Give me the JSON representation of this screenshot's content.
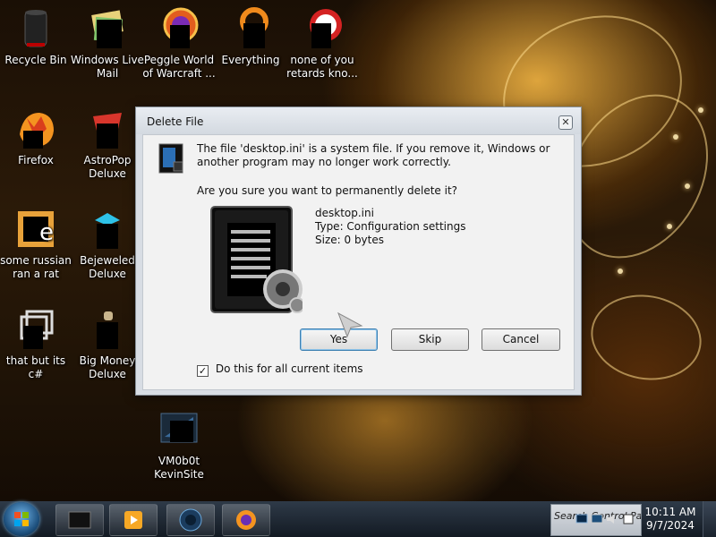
{
  "desktop": {
    "icons": [
      {
        "label": "Recycle Bin",
        "icon": "recycle-bin-icon"
      },
      {
        "label": "Windows Live Mail",
        "icon": "windows-live-mail-icon"
      },
      {
        "label": "Peggle World of Warcraft ...",
        "icon": "peggle-icon"
      },
      {
        "label": "Everything",
        "icon": "everything-icon"
      },
      {
        "label": "none of you retards kno...",
        "icon": "shortcut-icon"
      },
      {
        "label": "Firefox",
        "icon": "firefox-icon"
      },
      {
        "label": "AstroPop Deluxe",
        "icon": "astropop-icon"
      },
      {
        "label": "some russian ran a rat",
        "icon": "application-icon"
      },
      {
        "label": "Bejeweled Deluxe",
        "icon": "bejeweled-icon"
      },
      {
        "label": "that but its c#",
        "icon": "shortcut-icon"
      },
      {
        "label": "Big Money Deluxe",
        "icon": "big-money-icon"
      },
      {
        "label": "VM0b0t KevinSite",
        "icon": "vm-icon"
      }
    ]
  },
  "dialog": {
    "title": "Delete File",
    "close_symbol": "✕",
    "message": "The file 'desktop.ini' is a system file. If you remove it, Windows or another program may no longer work correctly.",
    "question": "Are you sure you want to permanently delete it?",
    "file": {
      "name": "desktop.ini",
      "type": "Type: Configuration settings",
      "size": "Size: 0 bytes"
    },
    "buttons": {
      "yes": "Yes",
      "skip": "Skip",
      "cancel": "Cancel"
    },
    "checkbox": {
      "label": "Do this for all current items",
      "checked": true,
      "mark": "✓"
    }
  },
  "taskbar": {
    "search_placeholder": "Search Control Panel",
    "clock": {
      "time": "10:11 AM",
      "date": "9/7/2024"
    }
  },
  "colors": {
    "accent": "#3c7fb1",
    "dialog_bg": "#f2f2f2",
    "taskbar": "#1b232d"
  }
}
